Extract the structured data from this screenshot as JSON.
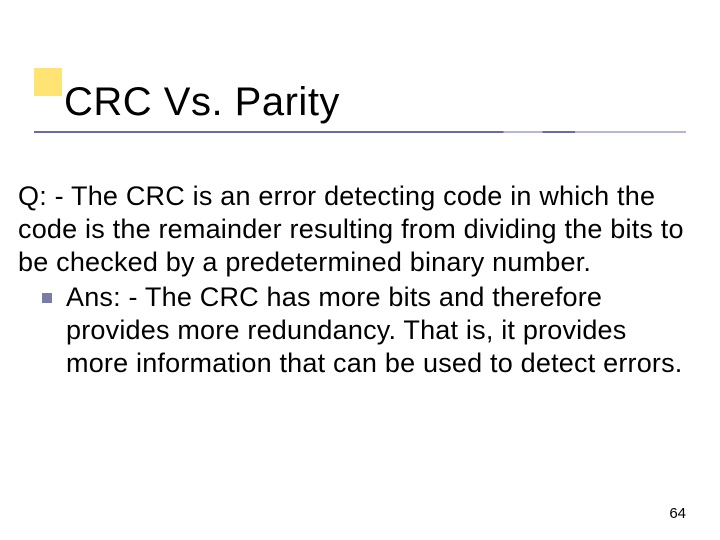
{
  "title": "CRC Vs. Parity",
  "question": "Q: - The CRC is an error detecting code in which the code is the remainder resulting from dividing the bits to be checked by a predetermined binary number.",
  "answer": "Ans: - The CRC has more bits and therefore provides more redundancy. That is, it provides more information that can be used to detect errors.",
  "page_number": "64"
}
